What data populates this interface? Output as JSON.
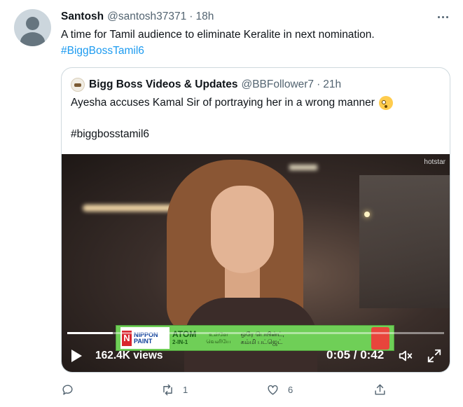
{
  "tweet": {
    "author_name": "Santosh",
    "handle": "@santosh37371",
    "separator": "·",
    "time": "18h",
    "text": "A time for Tamil audience to eliminate Keralite in next nomination.",
    "hashtag": "#BiggBossTamil6"
  },
  "quote": {
    "author_name": "Bigg Boss Videos & Updates",
    "handle": "@BBFollower7",
    "separator": "·",
    "time": "21h",
    "text": "Ayesha accuses Kamal Sir of portraying her in a wrong manner",
    "emoji": "flushed-face-emoji",
    "hashtag": "#biggbosstamil6",
    "video": {
      "watermark": "hotstar",
      "views": "162.4K views",
      "time": "0:05 / 0:42",
      "progress": 0.12,
      "ad": {
        "brand_letter": "N",
        "brand_line1": "NIPPON",
        "brand_line2": "PAINT",
        "product": "ATOM",
        "product_sub": "2-IN-1",
        "tamil_line1": "உள்ளே",
        "tamil_line2": "வெளியே",
        "tamil_line3": "ஒரே பெயின்ட்,",
        "tamil_line4": "கம்மி பட்ஜெட்"
      }
    }
  },
  "actions": {
    "reply_icon": "reply-icon",
    "retweet_icon": "retweet-icon",
    "retweet_count": "1",
    "like_icon": "like-icon",
    "like_count": "6",
    "share_icon": "share-icon"
  },
  "colors": {
    "accent": "#1d9bf0",
    "secondary_text": "#536471",
    "border": "#cfd9de"
  }
}
